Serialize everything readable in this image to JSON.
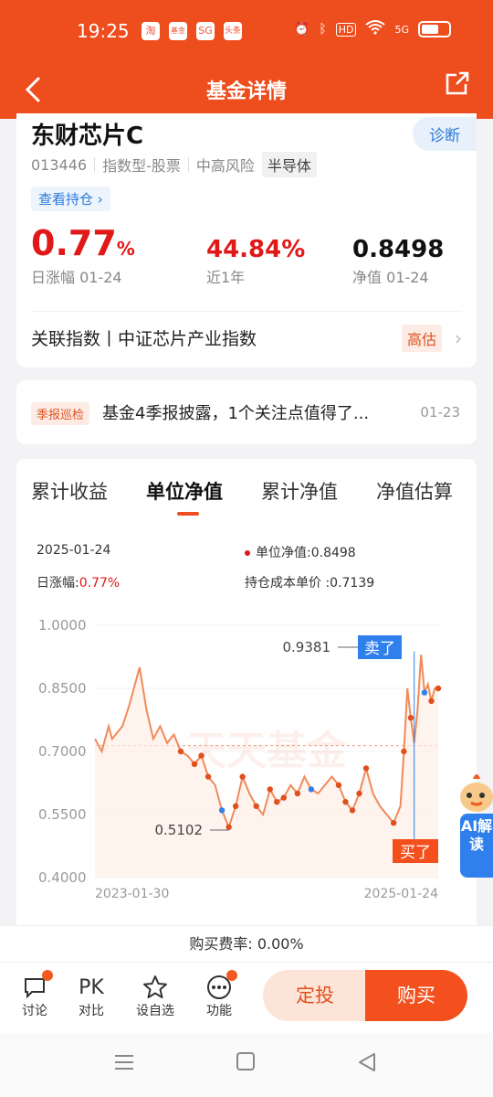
{
  "status_bar": {
    "time": "19:25",
    "apps": [
      "淘",
      "基金",
      "SG",
      "头条"
    ],
    "network": "5G",
    "hd": "HD"
  },
  "nav": {
    "title": "基金详情"
  },
  "fund": {
    "name": "东财芯片C",
    "code": "013446",
    "type": "指数型-股票",
    "risk": "中高风险",
    "sector": "半导体",
    "diagnose": "诊断",
    "holdings_link": "查看持仓 ›",
    "daily_change": "0.77",
    "daily_change_unit": "%",
    "daily_change_label": "日涨幅 01-24",
    "year_return": "44.84%",
    "year_return_label": "近1年",
    "nav_value": "0.8498",
    "nav_label": "净值 01-24",
    "index_label": "关联指数丨中证芯片产业指数",
    "valuation_badge": "高估"
  },
  "news": {
    "badge": "季报巡检",
    "text": "基金4季报披露，1个关注点值得了...",
    "date": "01-23"
  },
  "chart_tabs": [
    "累计收益",
    "单位净值",
    "累计净值",
    "净值估算"
  ],
  "chart_info": {
    "date": "2025-01-24",
    "nav_text": "单位净值:0.8498",
    "change_label": "日涨幅:",
    "change_value": "0.77%",
    "cost_text": "持仓成本单价 :0.7139"
  },
  "chart_data": {
    "type": "line",
    "ylim": [
      0.4,
      1.0
    ],
    "y_ticks": [
      "1.0000",
      "0.8500",
      "0.7000",
      "0.5500",
      "0.4000"
    ],
    "x_ticks": [
      "2023-01-30",
      "2025-01-24"
    ],
    "cost_line": 0.7139,
    "watermark": "天天基金",
    "x": [
      0,
      2,
      4,
      5,
      8,
      10,
      13,
      15,
      17,
      19,
      21,
      23,
      25,
      27,
      29,
      31,
      33,
      35,
      37,
      39,
      41,
      43,
      45,
      47,
      49,
      51,
      53,
      55,
      57,
      59,
      61,
      63,
      65,
      67,
      69,
      71,
      73,
      75,
      77,
      79,
      81,
      83,
      85,
      87,
      89,
      90,
      91,
      92,
      93,
      94,
      95,
      96,
      97,
      98,
      99,
      100
    ],
    "values": [
      0.73,
      0.7,
      0.76,
      0.73,
      0.76,
      0.81,
      0.9,
      0.8,
      0.73,
      0.76,
      0.72,
      0.74,
      0.7,
      0.69,
      0.67,
      0.69,
      0.64,
      0.62,
      0.56,
      0.52,
      0.57,
      0.64,
      0.6,
      0.57,
      0.55,
      0.61,
      0.58,
      0.59,
      0.62,
      0.6,
      0.64,
      0.61,
      0.6,
      0.62,
      0.64,
      0.62,
      0.58,
      0.56,
      0.6,
      0.66,
      0.6,
      0.57,
      0.55,
      0.53,
      0.57,
      0.7,
      0.85,
      0.78,
      0.72,
      0.8,
      0.93,
      0.84,
      0.86,
      0.82,
      0.85,
      0.85
    ],
    "annotations": [
      {
        "label": "0.9381",
        "x": 93,
        "y": 0.9381
      },
      {
        "label": "0.5102",
        "x": 39,
        "y": 0.5102
      }
    ],
    "sell_label": "卖了",
    "buy_label": "买了"
  },
  "fee": {
    "text": "购买费率: 0.00%"
  },
  "bottom": {
    "discuss": "讨论",
    "pk_icon": "PK",
    "compare": "对比",
    "watchlist": "设自选",
    "function": "功能",
    "sip": "定投",
    "buy": "购买"
  },
  "ai": {
    "label": "AI解读"
  }
}
